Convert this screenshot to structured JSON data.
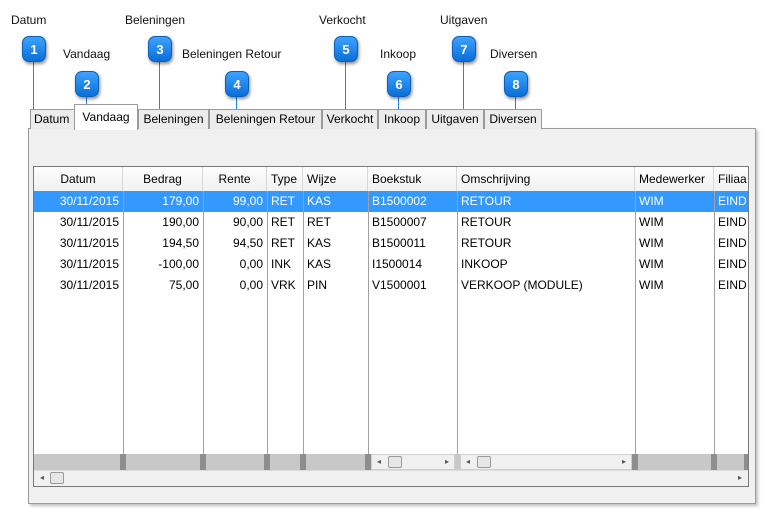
{
  "callouts": [
    {
      "label": "Datum",
      "number": "1"
    },
    {
      "label": "Vandaag",
      "number": "2"
    },
    {
      "label": "Beleningen",
      "number": "3"
    },
    {
      "label": "Beleningen Retour",
      "number": "4"
    },
    {
      "label": "Verkocht",
      "number": "5"
    },
    {
      "label": "Inkoop",
      "number": "6"
    },
    {
      "label": "Uitgaven",
      "number": "7"
    },
    {
      "label": "Diversen",
      "number": "8"
    }
  ],
  "tabs": [
    {
      "label": "Datum",
      "active": false
    },
    {
      "label": "Vandaag",
      "active": true
    },
    {
      "label": "Beleningen",
      "active": false
    },
    {
      "label": "Beleningen Retour",
      "active": false
    },
    {
      "label": "Verkocht",
      "active": false
    },
    {
      "label": "Inkoop",
      "active": false
    },
    {
      "label": "Uitgaven",
      "active": false
    },
    {
      "label": "Diversen",
      "active": false
    }
  ],
  "table": {
    "columns": [
      "Datum",
      "Bedrag",
      "Rente",
      "Type",
      "Wijze",
      "Boekstuk",
      "Omschrijving",
      "Medewerker",
      "Filiaa"
    ],
    "rows": [
      [
        "30/11/2015",
        "179,00",
        "99,00",
        "RET",
        "KAS",
        "B1500002",
        "RETOUR",
        "WIM",
        "EIND"
      ],
      [
        "30/11/2015",
        "190,00",
        "90,00",
        "RET",
        "RET",
        "B1500007",
        "RETOUR",
        "WIM",
        "EIND"
      ],
      [
        "30/11/2015",
        "194,50",
        "94,50",
        "RET",
        "KAS",
        "B1500011",
        "RETOUR",
        "WIM",
        "EIND"
      ],
      [
        "30/11/2015",
        "-100,00",
        "0,00",
        "INK",
        "KAS",
        "I1500014",
        "INKOOP",
        "WIM",
        "EIND"
      ],
      [
        "30/11/2015",
        "75,00",
        "0,00",
        "VRK",
        "PIN",
        "V1500001",
        "VERKOOP (MODULE)",
        "WIM",
        "EIND"
      ]
    ],
    "selected_row": 0
  },
  "scroll_icons": {
    "left": "◂",
    "right": "▸"
  }
}
